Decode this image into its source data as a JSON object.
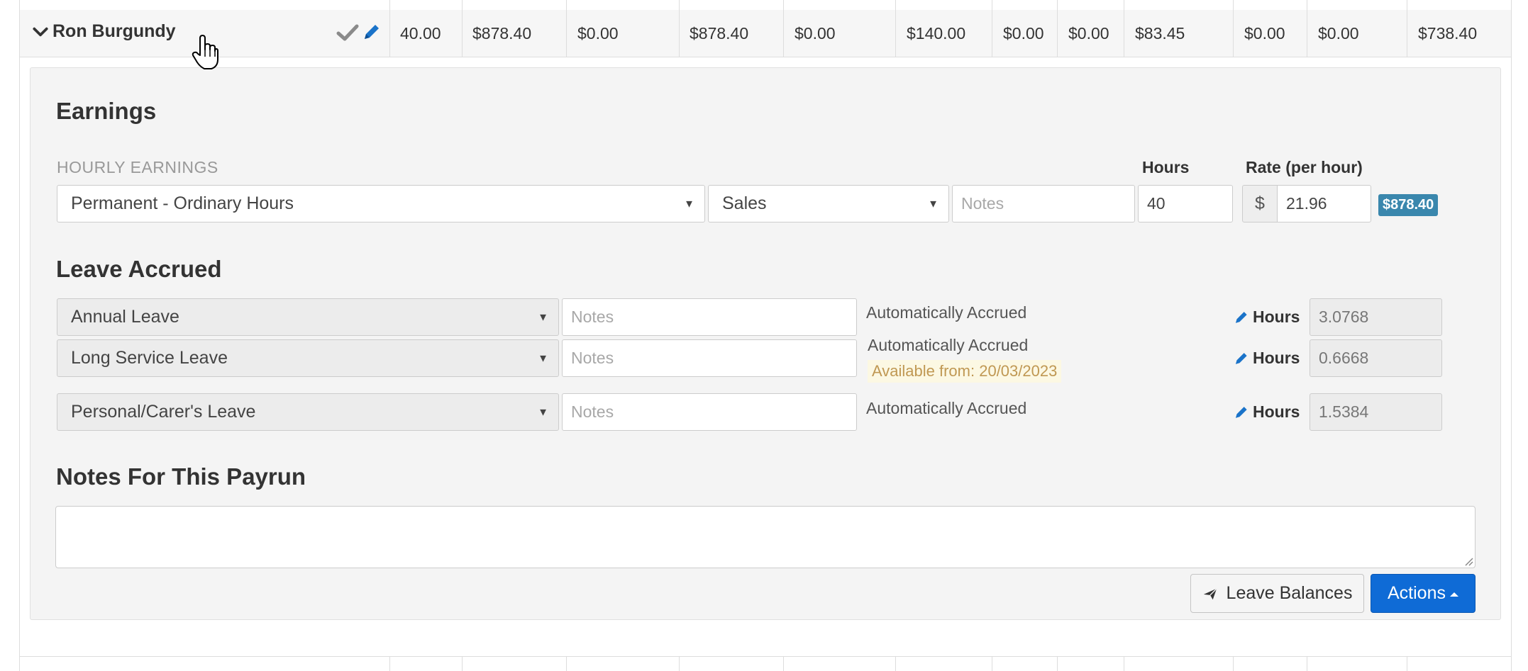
{
  "employee": {
    "name": "Ron Burgundy",
    "hours": "40.00",
    "gross": "$878.40",
    "pre_tax_deductions": "$0.00",
    "taxable_earnings": "$878.40",
    "post_tax_deductions": "$0.00",
    "tax": "$140.00",
    "col7": "$0.00",
    "col8": "$0.00",
    "super": "$83.45",
    "col10": "$0.00",
    "col11": "$0.00",
    "net": "$738.40"
  },
  "earnings": {
    "heading": "Earnings",
    "section_label": "HOURLY EARNINGS",
    "hours_label": "Hours",
    "rate_label": "Rate (per hour)",
    "pay_category": "Permanent - Ordinary Hours",
    "location": "Sales",
    "notes_placeholder": "Notes",
    "hours_value": "40",
    "currency_symbol": "$",
    "rate_value": "21.96",
    "total_badge": "$878.40"
  },
  "leave": {
    "heading": "Leave Accrued",
    "hours_label": "Hours",
    "items": [
      {
        "type": "Annual Leave",
        "notes_placeholder": "Notes",
        "status": "Automatically Accrued",
        "hours": "3.0768"
      },
      {
        "type": "Long Service Leave",
        "notes_placeholder": "Notes",
        "status": "Automatically Accrued",
        "available": "Available from: 20/03/2023",
        "hours": "0.6668"
      },
      {
        "type": "Personal/Carer's Leave",
        "notes_placeholder": "Notes",
        "status": "Automatically Accrued",
        "hours": "1.5384"
      }
    ]
  },
  "notes": {
    "heading": "Notes For This Payrun"
  },
  "buttons": {
    "leave_balances": "Leave Balances",
    "actions": "Actions"
  },
  "colors": {
    "primary": "#0f6bd6",
    "badge": "#3a87ad",
    "edit_icon": "#1a73c9"
  }
}
